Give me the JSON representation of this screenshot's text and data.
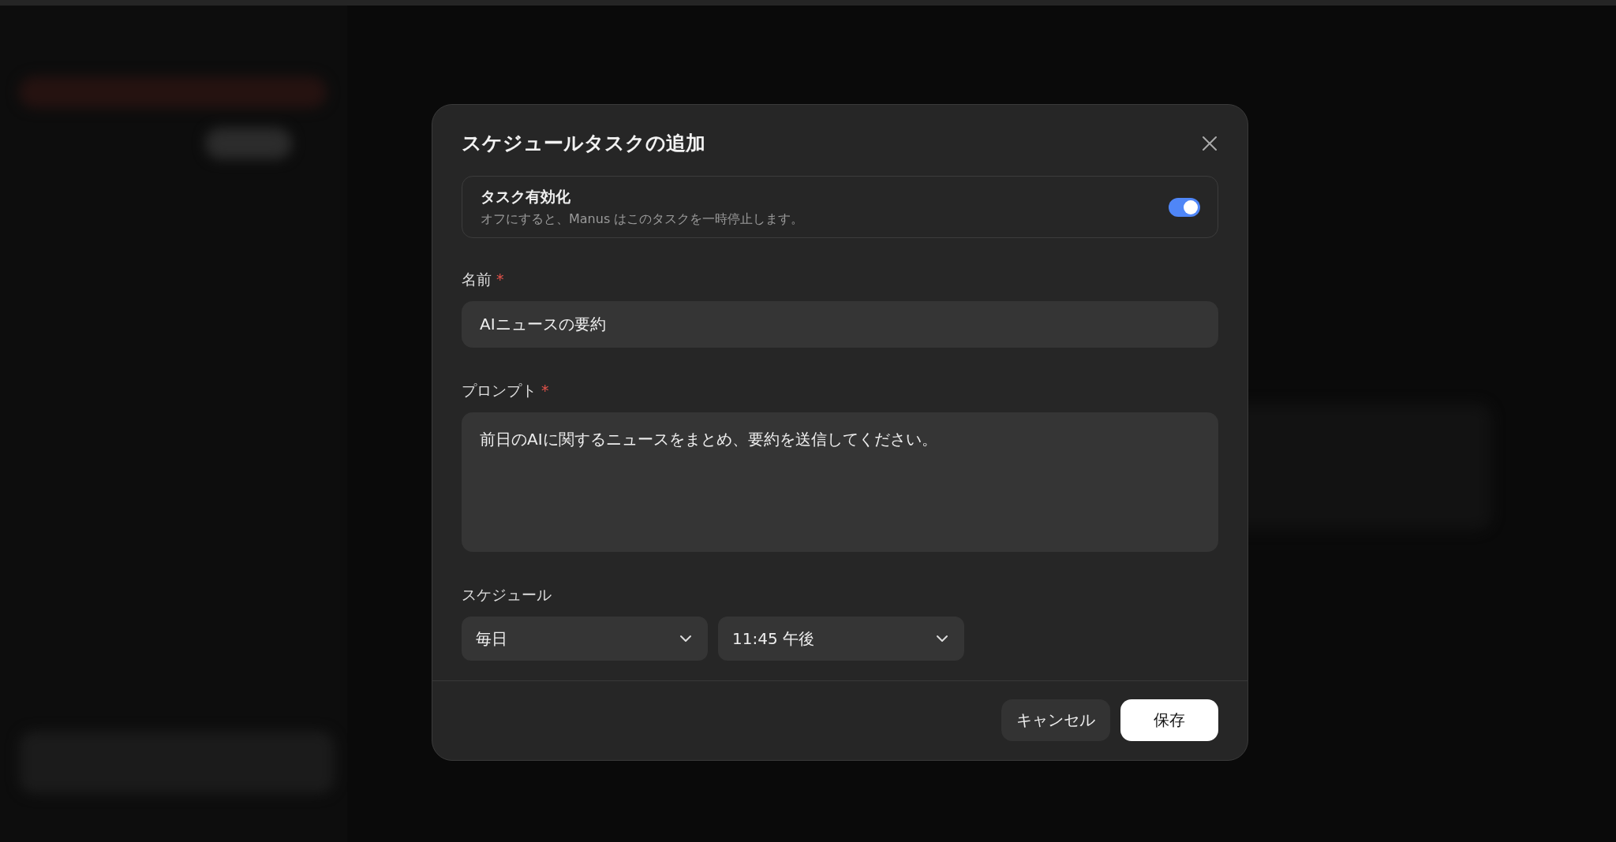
{
  "dialog": {
    "title": "スケジュールタスクの追加",
    "enable_task": {
      "label": "タスク有効化",
      "description": "オフにすると、Manus はこのタスクを一時停止します。",
      "on": true
    },
    "name": {
      "label": "名前",
      "required_marker": "*",
      "value": "AIニュースの要約"
    },
    "prompt": {
      "label": "プロンプト",
      "required_marker": "*",
      "value": "前日のAIに関するニュースをまとめ、要約を送信してください。"
    },
    "schedule": {
      "label": "スケジュール",
      "selects": [
        {
          "value": "毎日"
        },
        {
          "value": "11:45 午後"
        }
      ]
    },
    "buttons": [
      {
        "label": "キャンセル",
        "kind": "secondary"
      },
      {
        "label": "保存",
        "kind": "primary"
      }
    ]
  }
}
